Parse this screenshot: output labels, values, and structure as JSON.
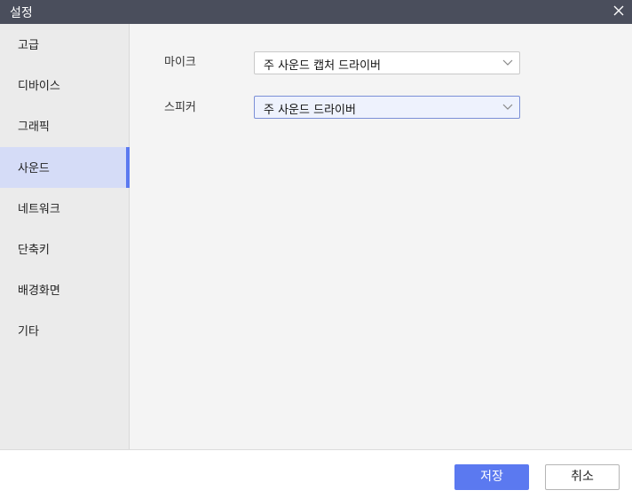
{
  "window": {
    "title": "설정",
    "close_icon": "close-icon"
  },
  "sidebar": {
    "items": [
      {
        "label": "고급",
        "active": false
      },
      {
        "label": "디바이스",
        "active": false
      },
      {
        "label": "그래픽",
        "active": false
      },
      {
        "label": "사운드",
        "active": true
      },
      {
        "label": "네트워크",
        "active": false
      },
      {
        "label": "단축키",
        "active": false
      },
      {
        "label": "배경화면",
        "active": false
      },
      {
        "label": "기타",
        "active": false
      }
    ]
  },
  "sound": {
    "microphone": {
      "label": "마이크",
      "value": "주 사운드 캡처 드라이버"
    },
    "speaker": {
      "label": "스피커",
      "value": "주 사운드 드라이버"
    }
  },
  "footer": {
    "save_label": "저장",
    "cancel_label": "취소"
  },
  "colors": {
    "accent": "#5b79f0",
    "titlebar": "#4a4e5c",
    "active_nav_bg": "#d5dcf7"
  }
}
